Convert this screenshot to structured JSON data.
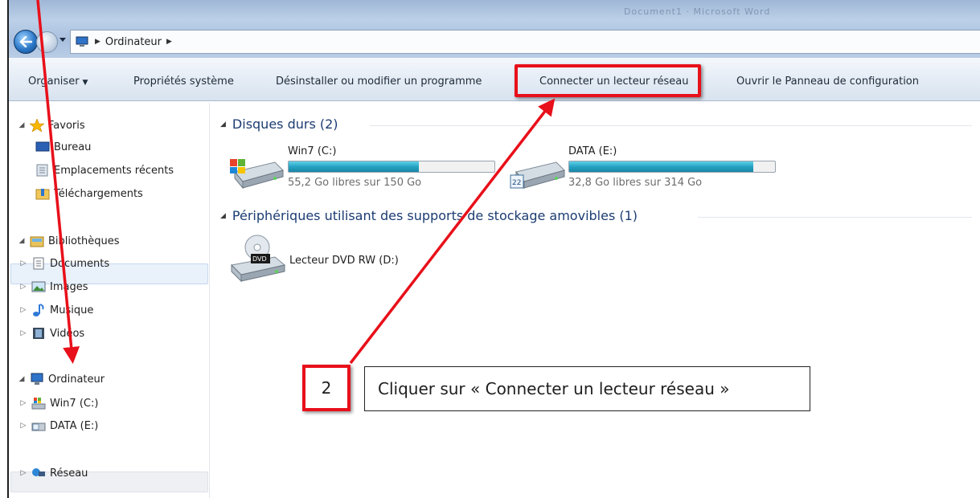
{
  "address_bar": {
    "location": "Ordinateur"
  },
  "title_ghost": "Document1 · Microsoft Word",
  "toolbar": {
    "organize_label": "Organiser",
    "properties_label": "Propriétés système",
    "uninstall_label": "Désinstaller ou modifier un programme",
    "map_drive_label": "Connecter un lecteur réseau",
    "control_panel_label": "Ouvrir le Panneau de configuration"
  },
  "sidebar": {
    "favorites": {
      "label": "Favoris",
      "items": [
        {
          "label": "Bureau",
          "icon": "desktop-icon"
        },
        {
          "label": "Emplacements récents",
          "icon": "recent-places-icon"
        },
        {
          "label": "Téléchargements",
          "icon": "downloads-folder-icon"
        }
      ]
    },
    "libraries": {
      "label": "Bibliothèques",
      "items": [
        {
          "label": "Documents",
          "icon": "documents-icon"
        },
        {
          "label": "Images",
          "icon": "images-icon"
        },
        {
          "label": "Musique",
          "icon": "music-icon"
        },
        {
          "label": "Vidéos",
          "icon": "videos-icon"
        }
      ]
    },
    "computer": {
      "label": "Ordinateur",
      "items": [
        {
          "label": "Win7 (C:)",
          "icon": "windows-drive-icon"
        },
        {
          "label": "DATA (E:)",
          "icon": "data-drive-icon"
        }
      ]
    },
    "network": {
      "label": "Réseau"
    }
  },
  "content": {
    "hard_drives_header": "Disques durs (2)",
    "drives": [
      {
        "name": "Win7 (C:)",
        "free": "55,2 Go libres sur 150 Go",
        "used_fraction": 0.632
      },
      {
        "name": "DATA (E:)",
        "free": "32,8 Go libres sur 314 Go",
        "used_fraction": 0.896
      }
    ],
    "removable_header": "Périphériques utilisant des supports de stockage amovibles (1)",
    "removable": [
      {
        "name": "Lecteur DVD RW (D:)",
        "badge": "DVD"
      }
    ]
  },
  "annotation": {
    "step_number": "2",
    "instruction": "Cliquer sur « Connecter un lecteur réseau »",
    "highlight_color": "#e8101a"
  }
}
